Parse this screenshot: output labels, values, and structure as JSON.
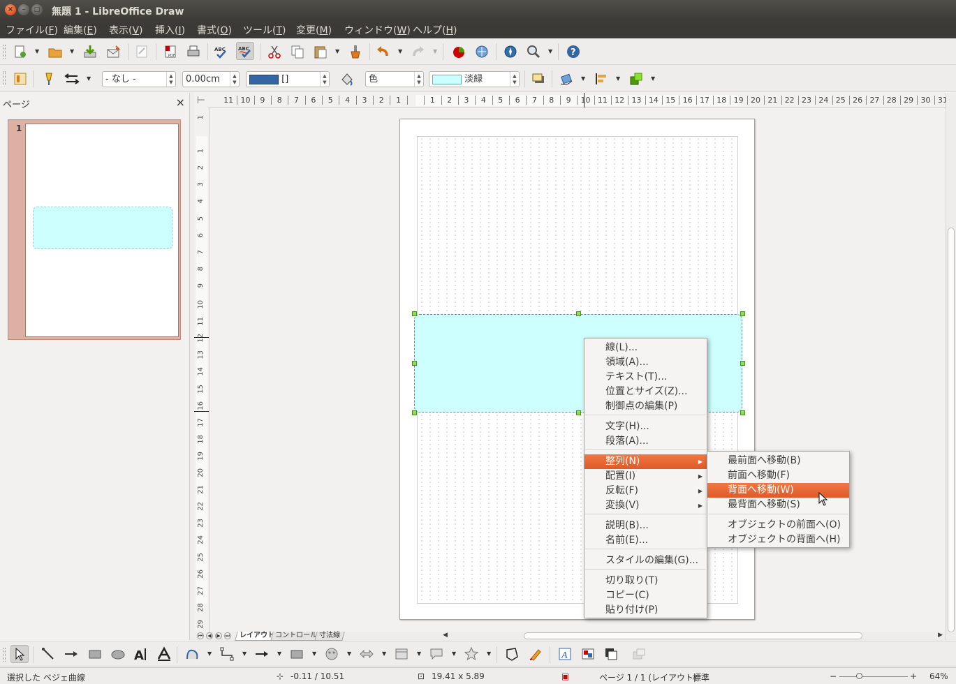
{
  "window": {
    "title": "無題 1 - LibreOffice Draw"
  },
  "menubar": [
    {
      "label": "ファイル(F)",
      "base": "ファイル(",
      "key": "F"
    },
    {
      "label": "編集(E)",
      "base": "編集(",
      "key": "E"
    },
    {
      "label": "表示(V)",
      "base": "表示(",
      "key": "V"
    },
    {
      "label": "挿入(I)",
      "base": "挿入(",
      "key": "I"
    },
    {
      "label": "書式(O)",
      "base": "書式(",
      "key": "O"
    },
    {
      "label": "ツール(T)",
      "base": "ツール(",
      "key": "T"
    },
    {
      "label": "変更(M)",
      "base": "変更(",
      "key": "M"
    },
    {
      "label": "ウィンドウ(W)",
      "base": "ウィンドウ(",
      "key": "W"
    },
    {
      "label": "ヘルプ(H)",
      "base": "ヘルプ(",
      "key": "H"
    }
  ],
  "line_toolbar": {
    "arrow_style": "- なし -",
    "line_width": "0.00cm",
    "line_color_label": "[]",
    "area_style": "色",
    "area_color": "淡緑",
    "line_color_hex": "#3465a4",
    "area_color_hex": "#ccffff"
  },
  "pages_pane": {
    "title": "ページ",
    "close": "×",
    "page_number": "1"
  },
  "ruler": {
    "h_ticks": [
      "11",
      "10",
      "9",
      "8",
      "7",
      "6",
      "5",
      "4",
      "3",
      "2",
      "1",
      "",
      "1",
      "2",
      "3",
      "4",
      "5",
      "6",
      "7",
      "8",
      "9",
      "10",
      "11",
      "12",
      "13",
      "14",
      "15",
      "16",
      "17",
      "18",
      "19",
      "20",
      "21",
      "22",
      "23",
      "24",
      "25",
      "26",
      "27",
      "28",
      "29",
      "30",
      "31"
    ],
    "v_ticks": [
      "1",
      "",
      "1",
      "2",
      "3",
      "4",
      "5",
      "6",
      "7",
      "8",
      "9",
      "10",
      "11",
      "12",
      "13",
      "14",
      "15",
      "16",
      "17",
      "18",
      "19",
      "20",
      "21",
      "22",
      "23",
      "24",
      "25",
      "26",
      "27",
      "28",
      "29"
    ]
  },
  "tabs": [
    "レイアウト",
    "コントロール",
    "寸法線"
  ],
  "context_menu": {
    "items": [
      "線(L)...",
      "領域(A)...",
      "テキスト(T)...",
      "位置とサイズ(Z)...",
      "制御点の編集(P)",
      "文字(H)...",
      "段落(A)...",
      "整列(N)",
      "配置(I)",
      "反転(F)",
      "変換(V)",
      "説明(B)...",
      "名前(E)...",
      "スタイルの編集(G)...",
      "切り取り(T)",
      "コピー(C)",
      "貼り付け(P)"
    ],
    "highlighted": "整列(N)",
    "submenu_items": [
      "最前面へ移動(B)",
      "前面へ移動(F)",
      "背面へ移動(W)",
      "最背面へ移動(S)",
      "オブジェクトの前面へ(O)",
      "オブジェクトの背面へ(H)"
    ],
    "submenu_highlighted": "背面へ移動(W)"
  },
  "statusbar": {
    "selection": "選択した ベジェ曲線",
    "position": "-0.11 / 10.51",
    "size": "19.41 x 5.89",
    "page": "ページ 1 / 1 (レイアウト)",
    "style": "標準",
    "zoom": "64%"
  },
  "icons": {
    "toolbar1": [
      "new-icon",
      "open-icon",
      "save-icon",
      "email-icon",
      "edit-file-icon",
      "export-pdf-icon",
      "print-icon",
      "spellcheck-icon",
      "autospell-icon",
      "cut-icon",
      "copy-icon",
      "paste-icon",
      "clone-format-icon",
      "undo-icon",
      "redo-icon",
      "chart-icon",
      "navigator-icon",
      "gallery-icon",
      "zoom-icon",
      "help-icon"
    ],
    "drawing": [
      "select-icon",
      "line-icon",
      "arrow-line-icon",
      "rectangle-icon",
      "ellipse-icon",
      "text-icon",
      "vertical-text-icon",
      "curve-icon",
      "connector-icon",
      "lines-arrows-icon",
      "basic-shapes-icon",
      "symbol-shapes-icon",
      "block-arrows-icon",
      "flowchart-icon",
      "callouts-icon",
      "stars-icon",
      "points-icon",
      "glue-points-icon",
      "fontwork-icon",
      "from-file-icon",
      "extrusion-icon",
      "3d-object-icon"
    ]
  }
}
